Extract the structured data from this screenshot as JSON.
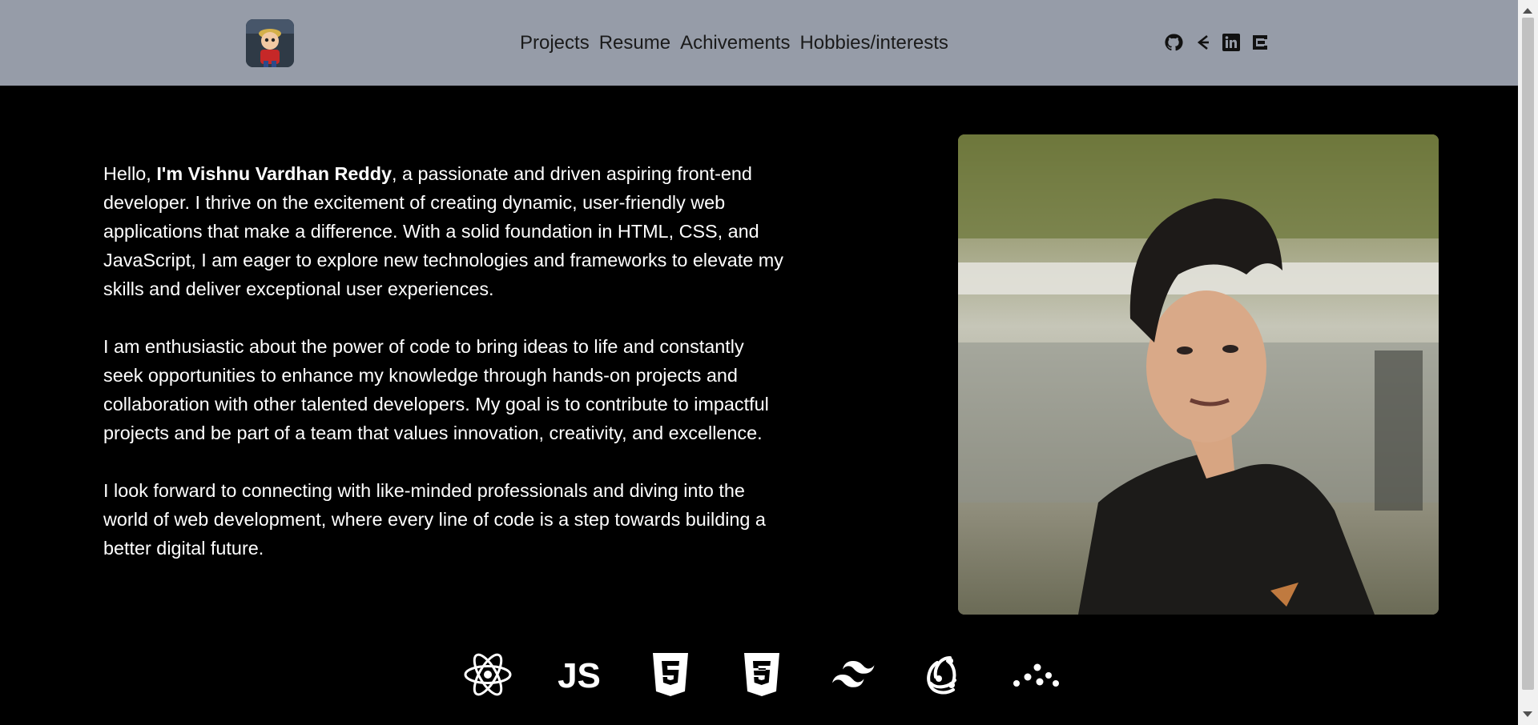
{
  "nav": {
    "items": [
      "Projects",
      "Resume",
      "Achivements",
      "Hobbies/interests"
    ]
  },
  "socials": [
    "github-icon",
    "geeksforgeeks-icon",
    "linkedin-icon",
    "codechef-icon"
  ],
  "intro": {
    "p1_start": "Hello, ",
    "p1_name": "I'm Vishnu Vardhan Reddy",
    "p1_rest": ", a passionate and driven aspiring front-end developer. I thrive on the excitement of creating dynamic, user-friendly web applications that make a difference. With a solid foundation in HTML, CSS, and JavaScript, I am eager to explore new technologies and frameworks to elevate my skills and deliver exceptional user experiences.",
    "p2": "I am enthusiastic about the power of code to bring ideas to life and constantly seek opportunities to enhance my knowledge through hands-on projects and collaboration with other talented developers. My goal is to contribute to impactful projects and be part of a team that values innovation, creativity, and excellence.",
    "p3": "I look forward to connecting with like-minded professionals and diving into the world of web development, where every line of code is a step towards building a better digital future."
  },
  "tech_icons": [
    "react-icon",
    "javascript-icon",
    "html5-icon",
    "css3-icon",
    "tailwind-icon",
    "redux-icon",
    "ember-icon"
  ],
  "colors": {
    "header_bg": "#969ca8",
    "page_bg": "#000000",
    "text": "#ffffff"
  }
}
